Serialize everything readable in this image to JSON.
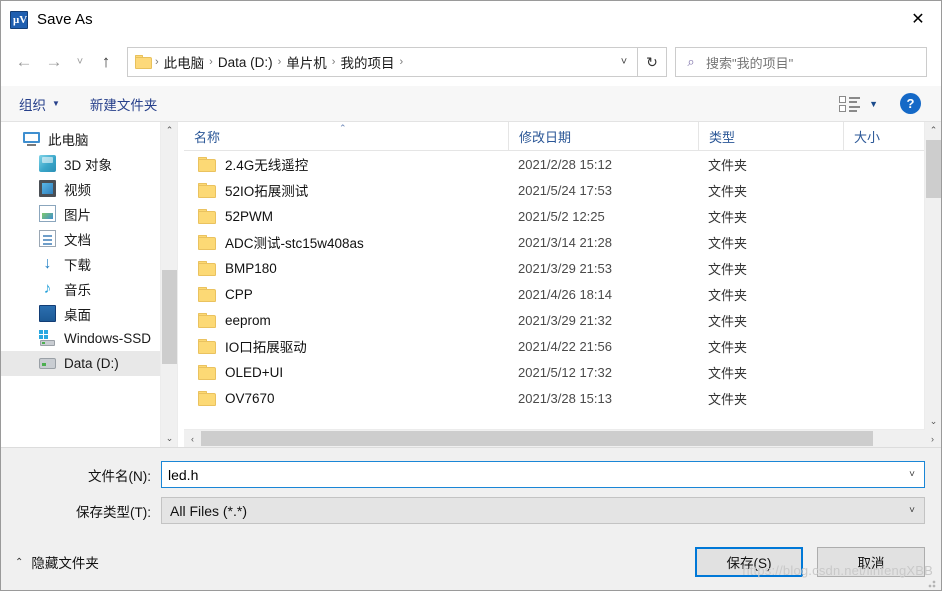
{
  "window": {
    "title": "Save As",
    "app_icon": "keil-uvision-icon",
    "close_label": "✕"
  },
  "nav": {
    "back_icon": "←",
    "forward_icon": "→",
    "recent_icon": "˅",
    "up_icon": "↑",
    "refresh_icon": "↻",
    "breadcrumb_dropdown_icon": "˅",
    "breadcrumb": [
      {
        "label": "此电脑",
        "sep": "›"
      },
      {
        "label": "Data (D:)",
        "sep": "›"
      },
      {
        "label": "单片机",
        "sep": "›"
      },
      {
        "label": "我的项目",
        "sep": "›"
      }
    ]
  },
  "search": {
    "icon": "⌕",
    "placeholder": "搜索\"我的项目\""
  },
  "commandbar": {
    "organize_label": "组织",
    "organize_caret": "▼",
    "new_folder_label": "新建文件夹",
    "view_caret": "▼",
    "help_label": "?"
  },
  "sidebar": {
    "items": [
      {
        "label": "此电脑",
        "icon": "computer-icon",
        "indent": false,
        "selected": false
      },
      {
        "label": "3D 对象",
        "icon": "3d-objects-icon",
        "indent": true,
        "selected": false
      },
      {
        "label": "视频",
        "icon": "videos-icon",
        "indent": true,
        "selected": false
      },
      {
        "label": "图片",
        "icon": "pictures-icon",
        "indent": true,
        "selected": false
      },
      {
        "label": "文档",
        "icon": "documents-icon",
        "indent": true,
        "selected": false
      },
      {
        "label": "下载",
        "icon": "downloads-icon",
        "indent": true,
        "selected": false
      },
      {
        "label": "音乐",
        "icon": "music-icon",
        "indent": true,
        "selected": false
      },
      {
        "label": "桌面",
        "icon": "desktop-icon",
        "indent": true,
        "selected": false
      },
      {
        "label": "Windows-SSD",
        "icon": "windows-drive-icon",
        "indent": true,
        "selected": false
      },
      {
        "label": "Data (D:)",
        "icon": "drive-icon",
        "indent": true,
        "selected": true
      }
    ],
    "scroll_up_icon": "⌃",
    "scroll_down_icon": "⌄"
  },
  "filelist": {
    "columns": [
      {
        "key": "name",
        "label": "名称",
        "sorted": "asc",
        "sort_icon": "⌃"
      },
      {
        "key": "date",
        "label": "修改日期"
      },
      {
        "key": "type",
        "label": "类型"
      },
      {
        "key": "size",
        "label": "大小"
      }
    ],
    "rows": [
      {
        "name": "2.4G无线遥控",
        "date": "2021/2/28 15:12",
        "type": "文件夹",
        "size": ""
      },
      {
        "name": "52IO拓展测试",
        "date": "2021/5/24 17:53",
        "type": "文件夹",
        "size": ""
      },
      {
        "name": "52PWM",
        "date": "2021/5/2 12:25",
        "type": "文件夹",
        "size": ""
      },
      {
        "name": "ADC测试-stc15w408as",
        "date": "2021/3/14 21:28",
        "type": "文件夹",
        "size": ""
      },
      {
        "name": "BMP180",
        "date": "2021/3/29 21:53",
        "type": "文件夹",
        "size": ""
      },
      {
        "name": "CPP",
        "date": "2021/4/26 18:14",
        "type": "文件夹",
        "size": ""
      },
      {
        "name": "eeprom",
        "date": "2021/3/29 21:32",
        "type": "文件夹",
        "size": ""
      },
      {
        "name": "IO口拓展驱动",
        "date": "2021/4/22 21:56",
        "type": "文件夹",
        "size": ""
      },
      {
        "name": "OLED+UI",
        "date": "2021/5/12 17:32",
        "type": "文件夹",
        "size": ""
      },
      {
        "name": "OV7670",
        "date": "2021/3/28 15:13",
        "type": "文件夹",
        "size": ""
      }
    ],
    "hscroll_left_icon": "‹",
    "hscroll_right_icon": "›",
    "vscroll_up_icon": "⌃",
    "vscroll_down_icon": "⌄"
  },
  "form": {
    "filename_label": "文件名(N):",
    "filename_value": "led.h",
    "filetype_label": "保存类型(T):",
    "filetype_value": "All Files (*.*)",
    "dropdown_icon": "˅"
  },
  "footer": {
    "hide_folders_label": "隐藏文件夹",
    "hide_folders_chevron": "⌃",
    "save_label": "保存(S)",
    "cancel_label": "取消",
    "watermark": "https://blog.csdn.net/linfengXBB"
  },
  "colors": {
    "accent": "#0078d7",
    "folder": "#fcd975",
    "header_text": "#2b5797",
    "command_text": "#27408b"
  }
}
